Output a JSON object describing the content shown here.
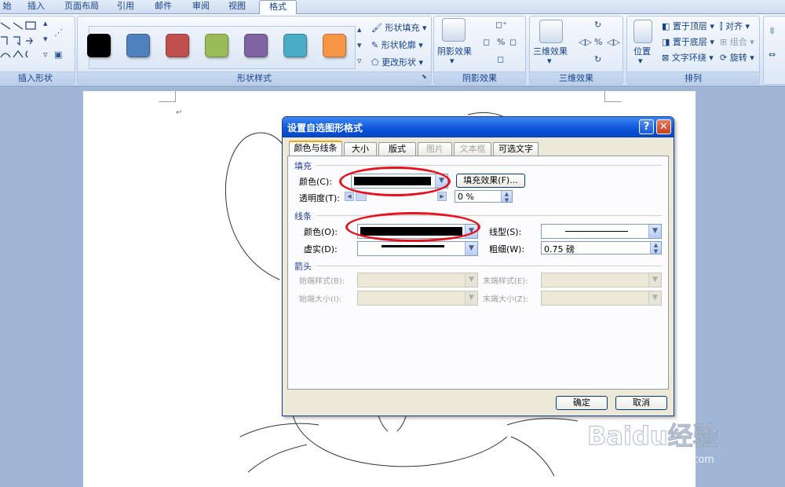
{
  "tabs": [
    "始",
    "插入",
    "页面布局",
    "引用",
    "邮件",
    "审阅",
    "视图",
    "格式"
  ],
  "active_tab": "格式",
  "ribbon": {
    "groups": {
      "insert_shapes": "插入形状",
      "shape_styles": "形状样式",
      "shadow_effects": "阴影效果",
      "three_d_effects": "三维效果",
      "arrange": "排列"
    },
    "shape_fill": "形状填充",
    "shape_outline": "形状轮廓",
    "change_shape": "更改形状",
    "shadow_effects_btn": "阴影效果",
    "three_d_btn": "三维效果",
    "position_btn": "位置",
    "bring_to_front": "置于顶层",
    "send_to_back": "置于底层",
    "text_wrap": "文字环绕",
    "align": "对齐",
    "group": "组合",
    "rotate": "旋转",
    "swatch_colors": [
      "#000000",
      "#4f81bd",
      "#c0504d",
      "#9bbb59",
      "#8064a2",
      "#4bacc6",
      "#f79646"
    ]
  },
  "dialog": {
    "title": "设置自选图形格式",
    "help": "?",
    "close": "✕",
    "tabs": [
      {
        "label": "颜色与线条",
        "state": "active"
      },
      {
        "label": "大小",
        "state": "normal"
      },
      {
        "label": "版式",
        "state": "normal"
      },
      {
        "label": "图片",
        "state": "disabled"
      },
      {
        "label": "文本框",
        "state": "disabled"
      },
      {
        "label": "可选文字",
        "state": "normal"
      }
    ],
    "fill": {
      "section": "填充",
      "color_label": "颜色(C):",
      "color_value": "#000000",
      "fill_effects_button": "填充效果(F)...",
      "transparency_label": "透明度(T):",
      "transparency_value": "0 %"
    },
    "line": {
      "section": "线条",
      "color_label": "颜色(O):",
      "color_value": "#000000",
      "dash_label": "虚实(D):",
      "style_label": "线型(S):",
      "weight_label": "粗细(W):",
      "weight_value": "0.75 磅"
    },
    "arrows": {
      "section": "箭头",
      "begin_style": "始端样式(B):",
      "begin_size": "始端大小(I):",
      "end_style": "末端样式(E):",
      "end_size": "末端大小(Z):"
    },
    "ok": "确定",
    "cancel": "取消"
  },
  "watermark": {
    "logo_text": "Baidu经验",
    "url": "jingyan.baidu.com"
  },
  "colors": {
    "highlight": "#e8101a",
    "titlebar": "#0a53d8"
  }
}
